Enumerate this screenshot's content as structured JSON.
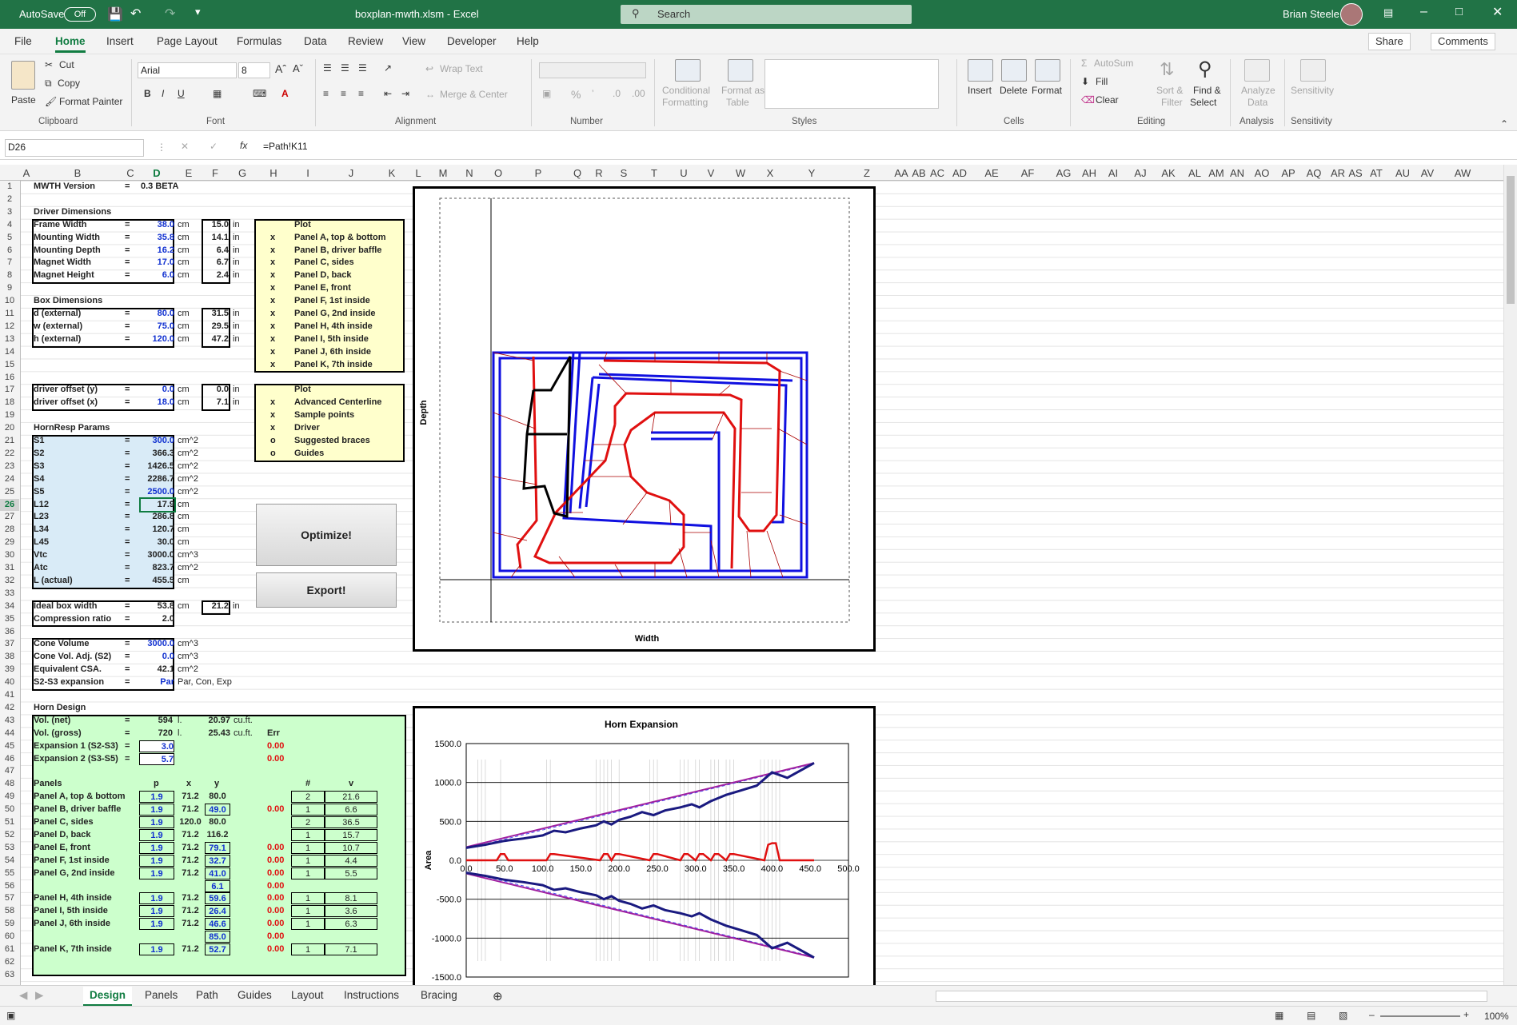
{
  "titlebar": {
    "autosave": "AutoSave",
    "autosave_state": "Off",
    "filename": "boxplan-mwth.xlsm - Excel",
    "search": "Search",
    "user": "Brian Steele"
  },
  "tabs": [
    "File",
    "Home",
    "Insert",
    "Page Layout",
    "Formulas",
    "Data",
    "Review",
    "View",
    "Developer",
    "Help"
  ],
  "share": "Share",
  "comments": "Comments",
  "ribbon": {
    "paste": "Paste",
    "cut": "Cut",
    "copy": "Copy",
    "format_painter": "Format Painter",
    "clipboard": "Clipboard",
    "font_name": "Arial",
    "font_size": "8",
    "font": "Font",
    "wrap_text": "Wrap Text",
    "merge_center": "Merge & Center",
    "alignment": "Alignment",
    "number": "Number",
    "conditional": "Conditional",
    "formatting": "Formatting",
    "format_as": "Format as",
    "table": "Table",
    "styles": "Styles",
    "insert": "Insert",
    "delete": "Delete",
    "format": "Format",
    "cells": "Cells",
    "autosum": "AutoSum",
    "fill": "Fill",
    "clear": "Clear",
    "sort_filter_1": "Sort &",
    "sort_filter_2": "Filter",
    "find_select_1": "Find &",
    "find_select_2": "Select",
    "editing": "Editing",
    "analyze_1": "Analyze",
    "analyze_2": "Data",
    "analysis": "Analysis",
    "sensitivity_btn": "Sensitivity",
    "sensitivity": "Sensitivity"
  },
  "formula_bar": {
    "name_box": "D26",
    "formula": "=Path!K11"
  },
  "columns": [
    "A",
    "B",
    "C",
    "D",
    "E",
    "F",
    "G",
    "H",
    "I",
    "J",
    "K",
    "L",
    "M",
    "N",
    "O",
    "P",
    "Q",
    "R",
    "S",
    "T",
    "U",
    "V",
    "W",
    "X",
    "Y",
    "Z",
    "AA",
    "AB",
    "AC",
    "AD",
    "AE",
    "AF",
    "AG",
    "AH",
    "AI",
    "AJ",
    "AK",
    "AL",
    "AM",
    "AN",
    "AO",
    "AP",
    "AQ",
    "AR",
    "AS",
    "AT",
    "AU",
    "AV",
    "AW"
  ],
  "rows": [
    "1",
    "2",
    "3",
    "4",
    "5",
    "6",
    "7",
    "8",
    "9",
    "10",
    "11",
    "12",
    "13",
    "14",
    "15",
    "16",
    "17",
    "18",
    "19",
    "20",
    "21",
    "22",
    "23",
    "24",
    "25",
    "26",
    "27",
    "28",
    "29",
    "30",
    "31",
    "32",
    "33",
    "34",
    "35",
    "36",
    "37",
    "38",
    "39",
    "40",
    "41",
    "42",
    "43",
    "44",
    "45",
    "46",
    "47",
    "48",
    "49",
    "50",
    "51",
    "52",
    "53",
    "54",
    "55",
    "56",
    "57",
    "58",
    "59",
    "60",
    "61",
    "62",
    "63"
  ],
  "sheet": {
    "version_label": "MWTH Version",
    "version_eq": "=",
    "version_value": "0.3 BETA",
    "driver_title": "Driver Dimensions",
    "driver": [
      {
        "label": "Frame Width",
        "eq": "=",
        "cm": "38.0",
        "unit": "cm",
        "in": "15.0",
        "iu": "in"
      },
      {
        "label": "Mounting Width",
        "eq": "=",
        "cm": "35.8",
        "unit": "cm",
        "in": "14.1",
        "iu": "in"
      },
      {
        "label": "Mounting Depth",
        "eq": "=",
        "cm": "16.2",
        "unit": "cm",
        "in": "6.4",
        "iu": "in"
      },
      {
        "label": "Magnet Width",
        "eq": "=",
        "cm": "17.0",
        "unit": "cm",
        "in": "6.7",
        "iu": "in"
      },
      {
        "label": "Magnet Height",
        "eq": "=",
        "cm": "6.0",
        "unit": "cm",
        "in": "2.4",
        "iu": "in"
      }
    ],
    "box_title": "Box Dimensions",
    "box": [
      {
        "label": "d (external)",
        "eq": "=",
        "cm": "80.0",
        "unit": "cm",
        "in": "31.5",
        "iu": "in"
      },
      {
        "label": "w (external)",
        "eq": "=",
        "cm": "75.0",
        "unit": "cm",
        "in": "29.5",
        "iu": "in"
      },
      {
        "label": "h (external)",
        "eq": "=",
        "cm": "120.0",
        "unit": "cm",
        "in": "47.2",
        "iu": "in"
      }
    ],
    "offset": [
      {
        "label": "driver offset (y)",
        "eq": "=",
        "cm": "0.0",
        "unit": "cm",
        "in": "0.0",
        "iu": "in"
      },
      {
        "label": "driver offset (x)",
        "eq": "=",
        "cm": "18.0",
        "unit": "cm",
        "in": "7.1",
        "iu": "in"
      }
    ],
    "hornresp_title": "HornResp Params",
    "hornresp": [
      {
        "label": "S1",
        "eq": "=",
        "v": "300.0",
        "u": "cm^2"
      },
      {
        "label": "S2",
        "eq": "=",
        "v": "366.3",
        "u": "cm^2"
      },
      {
        "label": "S3",
        "eq": "=",
        "v": "1426.5",
        "u": "cm^2"
      },
      {
        "label": "S4",
        "eq": "=",
        "v": "2286.7",
        "u": "cm^2"
      },
      {
        "label": "S5",
        "eq": "=",
        "v": "2500.0",
        "u": "cm^2"
      },
      {
        "label": "L12",
        "eq": "=",
        "v": "17.9",
        "u": "cm"
      },
      {
        "label": "L23",
        "eq": "=",
        "v": "286.8",
        "u": "cm"
      },
      {
        "label": "L34",
        "eq": "=",
        "v": "120.7",
        "u": "cm"
      },
      {
        "label": "L45",
        "eq": "=",
        "v": "30.0",
        "u": "cm"
      },
      {
        "label": "Vtc",
        "eq": "=",
        "v": "3000.0",
        "u": "cm^3"
      },
      {
        "label": "Atc",
        "eq": "=",
        "v": "823.7",
        "u": "cm^2"
      },
      {
        "label": "L (actual)",
        "eq": "=",
        "v": "455.5",
        "u": "cm"
      }
    ],
    "ideal": {
      "label": "Ideal box width",
      "eq": "=",
      "v": "53.8",
      "u": "cm",
      "in": "21.2",
      "iu": "in"
    },
    "compression": {
      "label": "Compression ratio",
      "eq": "=",
      "v": "2.0"
    },
    "cone": [
      {
        "label": "Cone Volume",
        "eq": "=",
        "v": "3000.0",
        "u": "cm^3"
      },
      {
        "label": "Cone Vol. Adj. (S2)",
        "eq": "=",
        "v": "0.0",
        "u": "cm^3"
      },
      {
        "label": "Equivalent CSA.",
        "eq": "=",
        "v": "42.1",
        "u": "cm^2"
      },
      {
        "label": "S2-S3 expansion",
        "eq": "=",
        "v": "Par",
        "u": "Par, Con, Exp"
      }
    ],
    "horn_design_title": "Horn Design",
    "vol_net": {
      "label": "Vol. (net)",
      "eq": "=",
      "v": "594",
      "u": "l.",
      "cf": "20.97",
      "cfu": "cu.ft."
    },
    "vol_gross": {
      "label": "Vol. (gross)",
      "eq": "=",
      "v": "720",
      "u": "l.",
      "cf": "25.43",
      "cfu": "cu.ft.",
      "err": "Err"
    },
    "exp1": {
      "label": "Expansion 1 (S2-S3)",
      "eq": "=",
      "v": "3.0",
      "err": "0.00"
    },
    "exp2": {
      "label": "Expansion 2 (S3-S5)",
      "eq": "=",
      "v": "5.7",
      "err": "0.00"
    },
    "panels_header": {
      "panels": "Panels",
      "p": "p",
      "x": "x",
      "y": "y",
      "n": "#",
      "v": "v"
    },
    "panels": [
      {
        "name": "Panel A, top & bottom",
        "p": "1.9",
        "x": "71.2",
        "y": "80.0",
        "e": "",
        "n": "2",
        "v": "21.6"
      },
      {
        "name": "Panel B, driver baffle",
        "p": "1.9",
        "x": "71.2",
        "y": "49.0",
        "e": "0.00",
        "n": "1",
        "v": "6.6"
      },
      {
        "name": "Panel C, sides",
        "p": "1.9",
        "x": "120.0",
        "y": "80.0",
        "e": "",
        "n": "2",
        "v": "36.5"
      },
      {
        "name": "Panel D, back",
        "p": "1.9",
        "x": "71.2",
        "y": "116.2",
        "e": "",
        "n": "1",
        "v": "15.7"
      },
      {
        "name": "Panel E, front",
        "p": "1.9",
        "x": "71.2",
        "y": "79.1",
        "e": "0.00",
        "n": "1",
        "v": "10.7"
      },
      {
        "name": "Panel F, 1st inside",
        "p": "1.9",
        "x": "71.2",
        "y": "32.7",
        "e": "0.00",
        "n": "1",
        "v": "4.4"
      },
      {
        "name": "Panel G, 2nd inside",
        "p": "1.9",
        "x": "71.2",
        "y": "41.0",
        "e": "0.00",
        "n": "1",
        "v": "5.5"
      },
      {
        "name": "",
        "p": "",
        "x": "",
        "y": "6.1",
        "e": "0.00",
        "n": "",
        "v": ""
      },
      {
        "name": "Panel H, 4th inside",
        "p": "1.9",
        "x": "71.2",
        "y": "59.6",
        "e": "0.00",
        "n": "1",
        "v": "8.1"
      },
      {
        "name": "Panel I, 5th inside",
        "p": "1.9",
        "x": "71.2",
        "y": "26.4",
        "e": "0.00",
        "n": "1",
        "v": "3.6"
      },
      {
        "name": "Panel J, 6th inside",
        "p": "1.9",
        "x": "71.2",
        "y": "46.6",
        "e": "0.00",
        "n": "1",
        "v": "6.3"
      },
      {
        "name": "",
        "p": "",
        "x": "",
        "y": "85.0",
        "e": "0.00",
        "n": "",
        "v": ""
      },
      {
        "name": "Panel K, 7th inside",
        "p": "1.9",
        "x": "71.2",
        "y": "52.7",
        "e": "0.00",
        "n": "1",
        "v": "7.1"
      }
    ],
    "plot_header": "Plot",
    "plot_items": [
      {
        "mark": "x",
        "label": "Panel A, top & bottom"
      },
      {
        "mark": "x",
        "label": "Panel B, driver baffle"
      },
      {
        "mark": "x",
        "label": "Panel C, sides"
      },
      {
        "mark": "x",
        "label": "Panel D, back"
      },
      {
        "mark": "x",
        "label": "Panel E, front"
      },
      {
        "mark": "x",
        "label": "Panel F, 1st inside"
      },
      {
        "mark": "x",
        "label": "Panel G, 2nd inside"
      },
      {
        "mark": "x",
        "label": "Panel H, 4th inside"
      },
      {
        "mark": "x",
        "label": "Panel I, 5th inside"
      },
      {
        "mark": "x",
        "label": "Panel J, 6th inside"
      },
      {
        "mark": "x",
        "label": "Panel K, 7th inside"
      }
    ],
    "plot2_header": "Plot",
    "plot2_items": [
      {
        "mark": "x",
        "label": "Advanced Centerline"
      },
      {
        "mark": "x",
        "label": "Sample points"
      },
      {
        "mark": "x",
        "label": "Driver"
      },
      {
        "mark": "o",
        "label": "Suggested braces"
      },
      {
        "mark": "o",
        "label": "Guides"
      }
    ],
    "optimize_btn": "Optimize!",
    "export_btn": "Export!"
  },
  "layout_chart": {
    "xlabel": "Width",
    "ylabel": "Depth"
  },
  "chart_data": {
    "type": "line",
    "title": "Horn Expansion",
    "xlabel": "",
    "ylabel": "Area",
    "xlim": [
      0,
      500
    ],
    "ylim": [
      -1500,
      1500
    ],
    "x_ticks": [
      "0.0",
      "50.0",
      "100.0",
      "150.0",
      "200.0",
      "250.0",
      "300.0",
      "350.0",
      "400.0",
      "450.0",
      "500.0"
    ],
    "y_ticks": [
      "1500.0",
      "1000.0",
      "500.0",
      "0.0",
      "-500.0",
      "-1000.0",
      "-1500.0"
    ],
    "series": [
      {
        "color": "#1a1a80",
        "x": [
          0,
          25,
          50,
          75,
          100,
          115,
          130,
          150,
          170,
          180,
          190,
          200,
          215,
          230,
          245,
          260,
          280,
          295,
          305,
          320,
          340,
          360,
          380,
          400,
          420,
          455
        ],
        "y": [
          160,
          200,
          250,
          280,
          320,
          380,
          360,
          410,
          450,
          500,
          460,
          520,
          560,
          620,
          580,
          640,
          680,
          720,
          680,
          760,
          840,
          900,
          960,
          1130,
          1060,
          1250
        ]
      },
      {
        "color": "#e01010",
        "x": [
          0,
          40,
          45,
          50,
          55,
          105,
          110,
          115,
          175,
          180,
          185,
          190,
          195,
          200,
          240,
          245,
          250,
          280,
          285,
          290,
          300,
          305,
          310,
          320,
          325,
          330,
          340,
          345,
          350,
          390,
          395,
          400,
          405,
          410,
          455
        ],
        "y": [
          0,
          0,
          80,
          80,
          0,
          0,
          80,
          80,
          0,
          80,
          80,
          0,
          80,
          80,
          0,
          80,
          80,
          0,
          80,
          80,
          0,
          80,
          80,
          0,
          80,
          80,
          0,
          80,
          80,
          0,
          200,
          220,
          220,
          0,
          0
        ]
      },
      {
        "color": "#1a1a80",
        "x": [
          0,
          25,
          50,
          75,
          100,
          115,
          130,
          150,
          170,
          180,
          190,
          200,
          215,
          230,
          245,
          260,
          280,
          295,
          305,
          320,
          340,
          360,
          380,
          400,
          420,
          455
        ],
        "y": [
          -160,
          -200,
          -250,
          -280,
          -320,
          -380,
          -360,
          -410,
          -450,
          -500,
          -460,
          -520,
          -560,
          -620,
          -580,
          -640,
          -680,
          -720,
          -680,
          -760,
          -840,
          -900,
          -960,
          -1130,
          -1060,
          -1250
        ]
      }
    ]
  },
  "sheet_tabs": [
    "Design",
    "Panels",
    "Path",
    "Guides",
    "Layout",
    "Instructions",
    "Bracing"
  ],
  "status": {
    "zoom": "100%"
  }
}
